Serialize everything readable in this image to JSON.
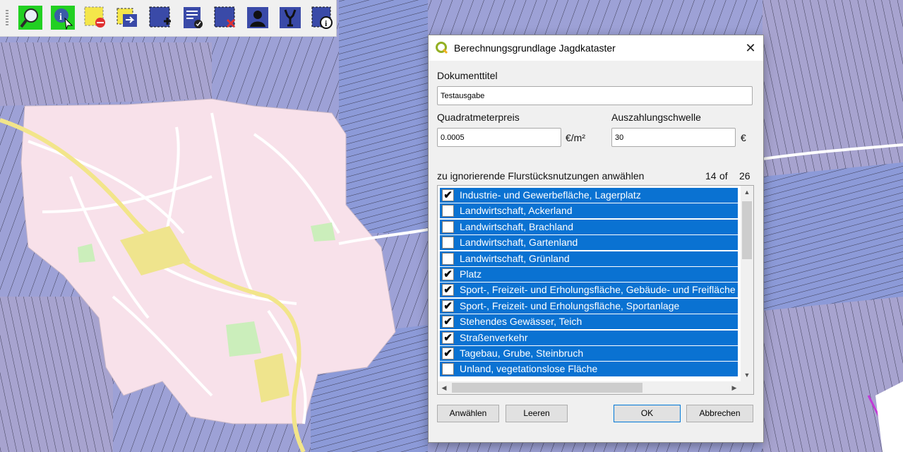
{
  "dialog": {
    "title": "Berechnungsgrundlage Jagdkataster",
    "close_symbol": "✕",
    "doc_title_label": "Dokumenttitel",
    "doc_title_value": "Testausgabe",
    "price_label": "Quadratmeterpreis",
    "price_value": "0.0005",
    "price_unit": "€/m²",
    "threshold_label": "Auszahlungschwelle",
    "threshold_value": "30",
    "threshold_unit": "€",
    "ignore_label": "zu ignorierende Flurstücksnutzungen anwählen",
    "count_selected": "14",
    "count_of": "of",
    "count_total": "26",
    "items": [
      {
        "label": "Industrie- und Gewerbefläche, Lagerplatz",
        "checked": true
      },
      {
        "label": "Landwirtschaft, Ackerland",
        "checked": false
      },
      {
        "label": "Landwirtschaft, Brachland",
        "checked": false
      },
      {
        "label": "Landwirtschaft, Gartenland",
        "checked": false
      },
      {
        "label": "Landwirtschaft, Grünland",
        "checked": false
      },
      {
        "label": "Platz",
        "checked": true
      },
      {
        "label": "Sport-, Freizeit- und Erholungsfläche, Gebäude- und Freifläche S",
        "checked": true
      },
      {
        "label": "Sport-, Freizeit- und Erholungsfläche, Sportanlage",
        "checked": true
      },
      {
        "label": "Stehendes Gewässer, Teich",
        "checked": true
      },
      {
        "label": "Straßenverkehr",
        "checked": true
      },
      {
        "label": "Tagebau, Grube, Steinbruch",
        "checked": true
      },
      {
        "label": "Unland, vegetationslose Fläche",
        "checked": false
      }
    ],
    "check_glyph": "✔",
    "buttons": {
      "select": "Anwählen",
      "clear": "Leeren",
      "ok": "OK",
      "cancel": "Abbrechen"
    }
  },
  "toolbar": {
    "icons": [
      "zoom-select-icon",
      "identify-icon",
      "deselect-icon",
      "move-selection-icon",
      "add-feature-icon",
      "report-icon",
      "remove-feature-icon",
      "owner-icon",
      "hunting-icon",
      "info-icon"
    ]
  },
  "colors": {
    "selection": "#0a72d2",
    "map_parcel": "#9a9fd6",
    "map_town": "#f8e1ea",
    "map_border": "#3a3a4a"
  }
}
